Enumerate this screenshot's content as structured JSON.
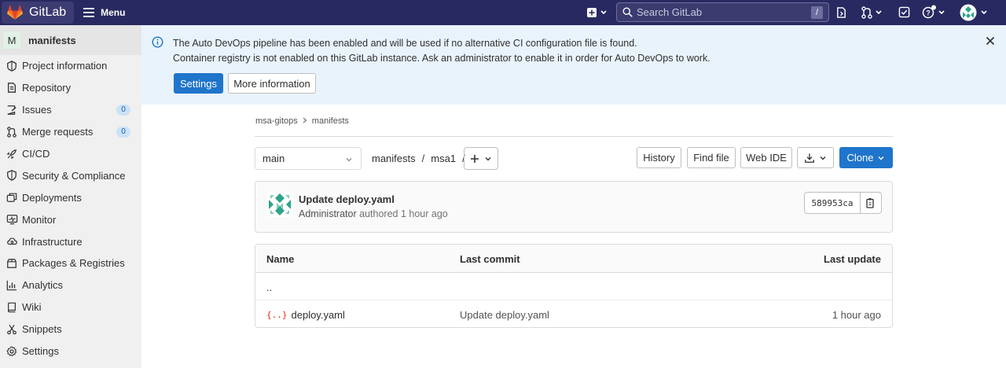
{
  "navbar": {
    "brand": "GitLab",
    "menu_label": "Menu",
    "search_placeholder": "Search GitLab",
    "search_shortcut": "/",
    "colors": {
      "background": "#292961",
      "logo_orange": "#e2432a"
    },
    "icons": [
      "create-new-icon",
      "code-review-icon",
      "merge-request-icon",
      "todo-icon",
      "help-icon",
      "user-avatar"
    ]
  },
  "sidebar": {
    "project_letter": "M",
    "project_name": "manifests",
    "items": [
      {
        "label": "Project information",
        "icon": "project-info-icon"
      },
      {
        "label": "Repository",
        "icon": "repository-icon"
      },
      {
        "label": "Issues",
        "icon": "issues-icon",
        "count": "0"
      },
      {
        "label": "Merge requests",
        "icon": "merge-request-icon",
        "count": "0"
      },
      {
        "label": "CI/CD",
        "icon": "rocket-icon"
      },
      {
        "label": "Security & Compliance",
        "icon": "shield-icon"
      },
      {
        "label": "Deployments",
        "icon": "deployments-icon"
      },
      {
        "label": "Monitor",
        "icon": "monitor-icon"
      },
      {
        "label": "Infrastructure",
        "icon": "cloud-icon"
      },
      {
        "label": "Packages & Registries",
        "icon": "package-icon"
      },
      {
        "label": "Analytics",
        "icon": "analytics-icon"
      },
      {
        "label": "Wiki",
        "icon": "book-icon"
      },
      {
        "label": "Snippets",
        "icon": "snippet-icon"
      },
      {
        "label": "Settings",
        "icon": "settings-icon"
      }
    ]
  },
  "banner": {
    "line1": "The Auto DevOps pipeline has been enabled and will be used if no alternative CI configuration file is found.",
    "line2": "Container registry is not enabled on this GitLab instance. Ask an administrator to enable it in order for Auto DevOps to work.",
    "settings_label": "Settings",
    "more_label": "More information",
    "color": "#e9f3fc"
  },
  "breadcrumb": {
    "group": "msa-gitops",
    "project": "manifests"
  },
  "toolbar": {
    "branch": "main",
    "path_parts": [
      "manifests",
      "msa1"
    ],
    "history": "History",
    "find_file": "Find file",
    "web_ide": "Web IDE",
    "clone": "Clone"
  },
  "commit": {
    "title": "Update deploy.yaml",
    "author": "Administrator",
    "authored_text": "authored 1 hour ago",
    "sha": "589953ca"
  },
  "tree": {
    "headers": {
      "name": "Name",
      "last_commit": "Last commit",
      "last_update": "Last update"
    },
    "parent": "..",
    "files": [
      {
        "name": "deploy.yaml",
        "icon": "{..}",
        "last_commit": "Update deploy.yaml",
        "last_update": "1 hour ago"
      }
    ]
  }
}
